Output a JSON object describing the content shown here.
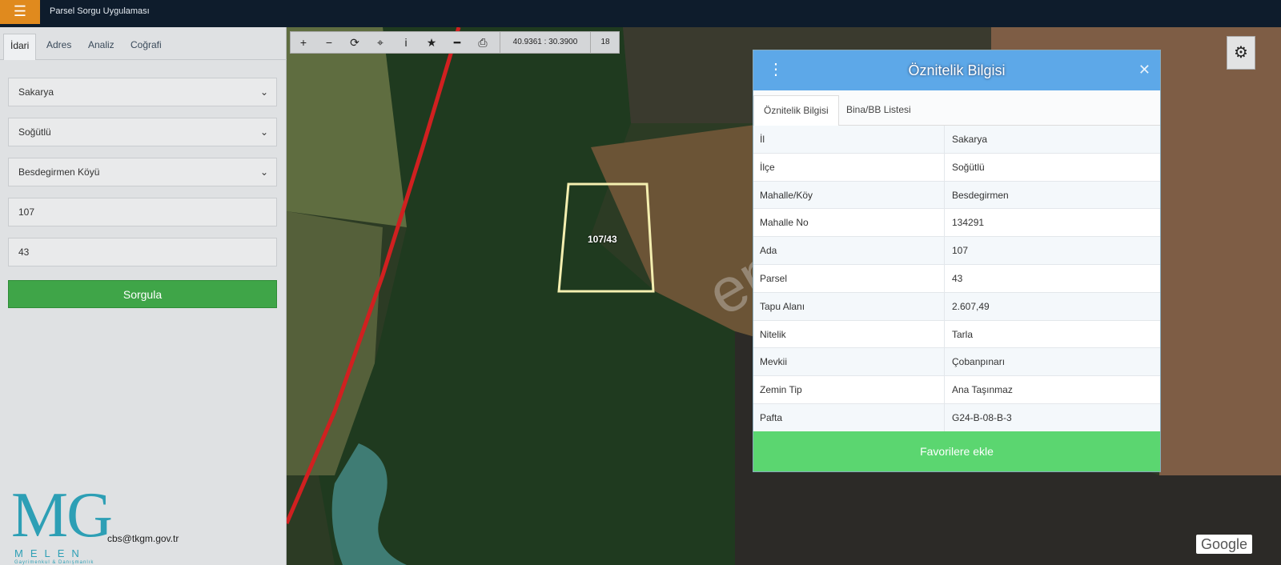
{
  "header": {
    "menu_icon": "hamburger-icon",
    "title": "Parsel Sorgu Uygulaması"
  },
  "sidebar": {
    "tabs": [
      "İdari",
      "Adres",
      "Analiz",
      "Coğrafi"
    ],
    "active_tab": "İdari",
    "il": "Sakarya",
    "ilce": "Soğütlü",
    "mahalle": "Besdegirmen Köyü",
    "ada": "107",
    "parsel": "43",
    "query_button": "Sorgula",
    "logo": {
      "letters": "MG",
      "name": "MELEN",
      "sub": "Gayrimenkul & Danışmanlık"
    },
    "contact": "cbs@tkgm.gov.tr"
  },
  "toolbar": {
    "buttons": [
      "zoom-in-icon",
      "zoom-out-icon",
      "refresh-icon",
      "locate-icon",
      "info-icon",
      "star-icon",
      "measure-icon",
      "print-icon"
    ],
    "coordinates": "40.9361 : 30.3900",
    "zoom": "18"
  },
  "map": {
    "parcel_label": "107/43",
    "watermark": "emlakjet.com",
    "attribution": "Google"
  },
  "popup": {
    "title": "Öznitelik Bilgisi",
    "tabs": [
      "Öznitelik Bilgisi",
      "Bina/BB Listesi"
    ],
    "rows": [
      {
        "key": "İl",
        "value": "Sakarya"
      },
      {
        "key": "İlçe",
        "value": "Soğütlü"
      },
      {
        "key": "Mahalle/Köy",
        "value": "Besdegirmen"
      },
      {
        "key": "Mahalle No",
        "value": "134291"
      },
      {
        "key": "Ada",
        "value": "107"
      },
      {
        "key": "Parsel",
        "value": "43"
      },
      {
        "key": "Tapu Alanı",
        "value": "2.607,49"
      },
      {
        "key": "Nitelik",
        "value": "Tarla"
      },
      {
        "key": "Mevkii",
        "value": "Çobanpınarı"
      },
      {
        "key": "Zemin Tip",
        "value": "Ana Taşınmaz"
      },
      {
        "key": "Pafta",
        "value": "G24-B-08-B-3"
      }
    ],
    "favorite_button": "Favorilere ekle"
  },
  "colors": {
    "header": "#0e1c2c",
    "menu": "#e08a1e",
    "query": "#3fa548",
    "popup_head": "#5da8e8",
    "favorite": "#5bd670",
    "parcel_border": "#f4efb0",
    "road": "#d02020"
  }
}
